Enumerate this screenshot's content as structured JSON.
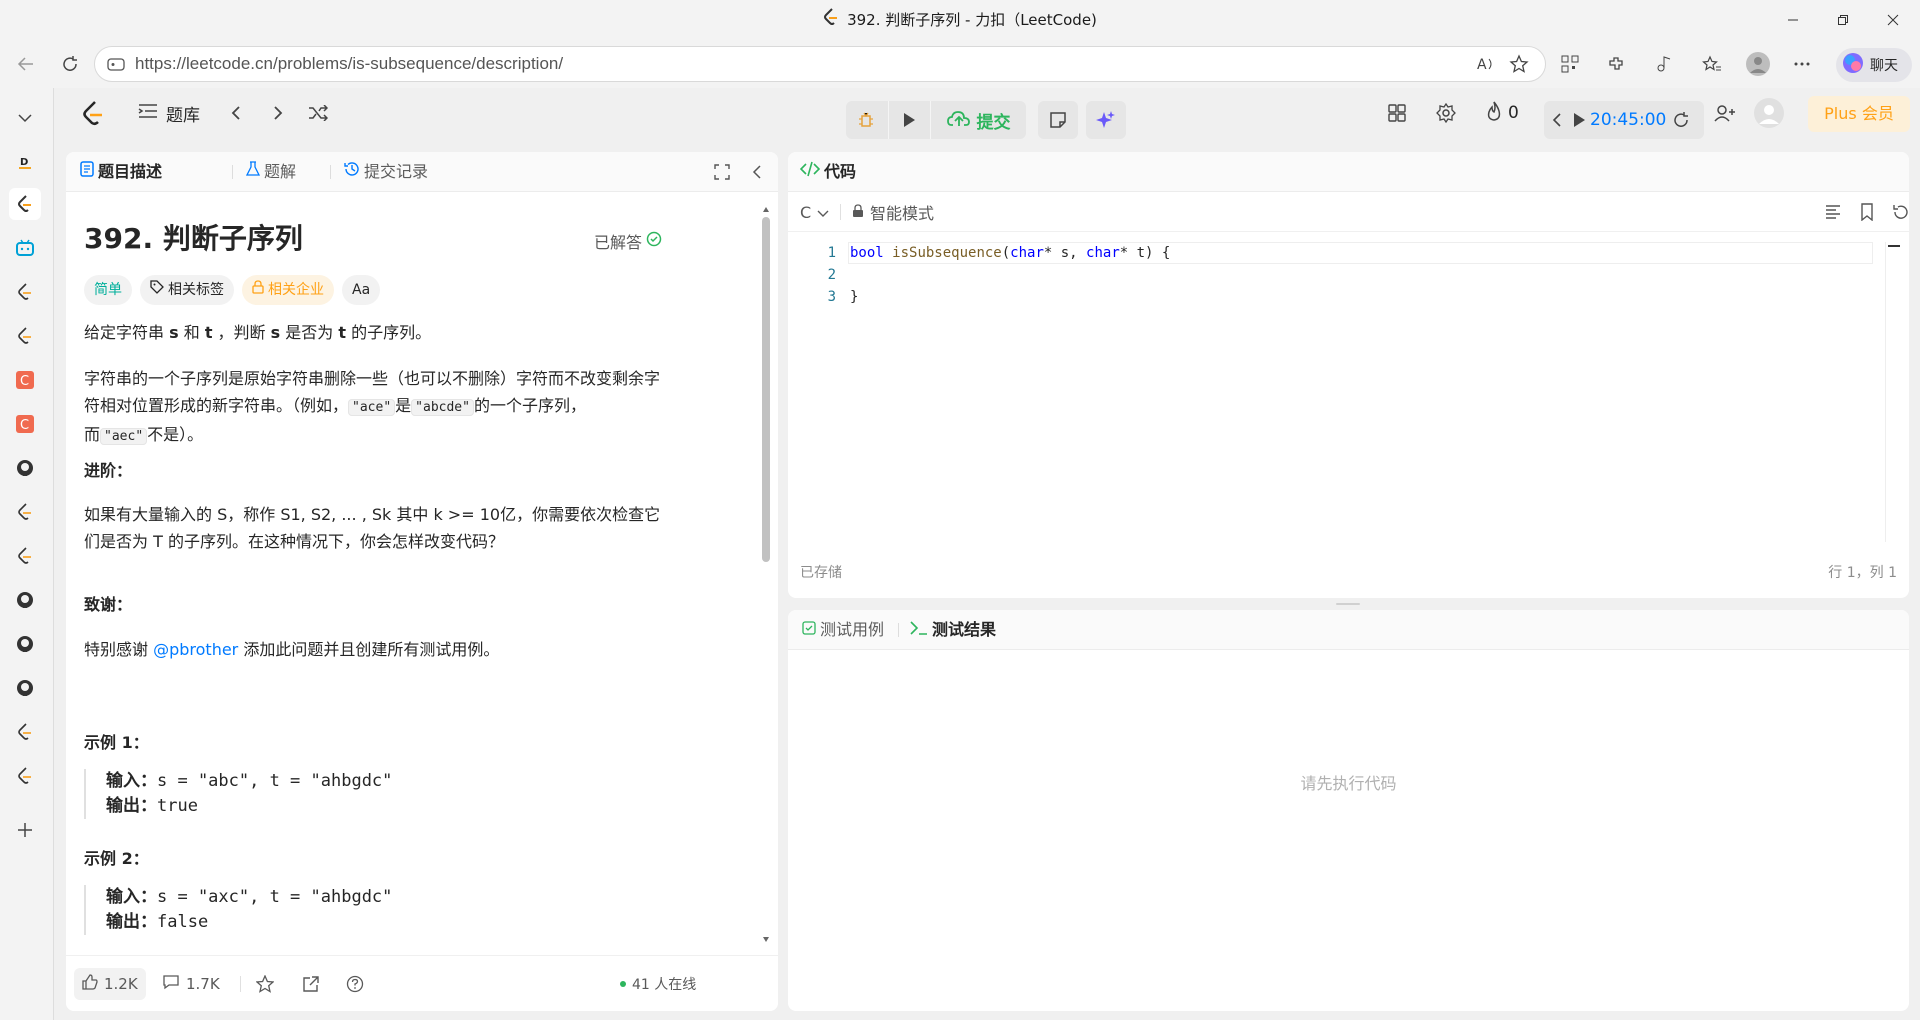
{
  "browser": {
    "window_title": "392. 判断子序列 - 力扣（LeetCode)",
    "url": "https://leetcode.cn/problems/is-subsequence/description/",
    "chat_label": "聊天"
  },
  "sidebar": {
    "icons": [
      "chevron-down-icon",
      "dxy-icon",
      "leetcode-icon",
      "bilibili-icon",
      "leetcode-icon",
      "leetcode-icon",
      "c-icon",
      "c-icon",
      "github-icon",
      "leetcode-icon",
      "leetcode-icon",
      "github-icon",
      "github-icon",
      "github-icon",
      "leetcode-icon",
      "leetcode-icon",
      "add-icon"
    ]
  },
  "topnav": {
    "problem_list": "题库",
    "submit": "提交",
    "streak": "0",
    "timer": "20:45:00",
    "plus": "Plus 会员"
  },
  "left_panel": {
    "tabs": [
      "题目描述",
      "题解",
      "提交记录"
    ],
    "title": "392. 判断子序列",
    "status": "已解答",
    "tags": [
      "简单",
      "相关标签",
      "相关企业",
      "Aa"
    ],
    "p1_a": "给定字符串 ",
    "p1_s": "s",
    "p1_b": " 和 ",
    "p1_t": "t",
    "p1_c": " ，判断 ",
    "p1_s2": "s",
    "p1_d": " 是否为 ",
    "p1_t2": "t",
    "p1_e": " 的子序列。",
    "p2_a": "字符串的一个子序列是原始字符串删除一些（也可以不删除）字符而不改变剩余字符相对位置形成的新字符串。（例如，",
    "p2_code1": "\"ace\"",
    "p2_b": "是",
    "p2_code2": "\"abcde\"",
    "p2_c": "的一个子序列，而",
    "p2_code3": "\"aec\"",
    "p2_d": "不是）。",
    "advanced_heading": "进阶：",
    "advanced_text": "如果有大量输入的 S，称作 S1, S2, ... , Sk 其中 k >= 10亿，你需要依次检查它们是否为 T 的子序列。在这种情况下，你会怎样改变代码？",
    "thanks_heading": "致谢：",
    "thanks_a": "特别感谢 ",
    "thanks_link": "@pbrother",
    "thanks_b": " 添加此问题并且创建所有测试用例。",
    "example1_heading": "示例 1：",
    "example1_in_label": "输入：",
    "example1_in": "s = \"abc\", t = \"ahbgdc\"",
    "example1_out_label": "输出：",
    "example1_out": "true",
    "example2_heading": "示例 2：",
    "example2_in_label": "输入：",
    "example2_in": "s = \"axc\", t = \"ahbgdc\"",
    "example2_out_label": "输出：",
    "example2_out": "false",
    "likes": "1.2K",
    "comments": "1.7K",
    "online": "41 人在线"
  },
  "code_panel": {
    "tab": "代码",
    "language": "C",
    "mode": "智能模式",
    "lines": [
      {
        "num": "1"
      },
      {
        "num": "2"
      },
      {
        "num": "3",
        "text": "}"
      }
    ],
    "l1_kw": "bool",
    "l1_fn": "isSubsequence",
    "l1_p1": "(",
    "l1_ty1": "char",
    "l1_p2": "* s, ",
    "l1_ty2": "char",
    "l1_p3": "* t) {",
    "saved": "已存储",
    "cursor": "行 1，列 1"
  },
  "test_panel": {
    "tabs": [
      "测试用例",
      "测试结果"
    ],
    "empty_message": "请先执行代码"
  },
  "colors": {
    "green": "#2db55d",
    "easy": "#00af9b",
    "link": "#007aff",
    "gold": "#ffa116"
  }
}
